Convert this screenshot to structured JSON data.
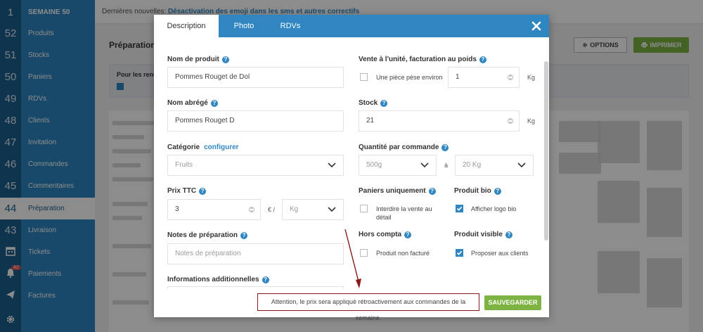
{
  "sidebar": {
    "week": {
      "num": "1",
      "label": "SEMAINE 50"
    },
    "items": [
      {
        "num": "52",
        "label": "Produits"
      },
      {
        "num": "51",
        "label": "Stocks"
      },
      {
        "num": "50",
        "label": "Paniers"
      },
      {
        "num": "49",
        "label": "RDVs"
      },
      {
        "num": "48",
        "label": "Clients"
      },
      {
        "num": "47",
        "label": "Invitation"
      },
      {
        "num": "46",
        "label": "Commandes"
      },
      {
        "num": "45",
        "label": "Commentaires"
      },
      {
        "num": "44",
        "label": "Préparation"
      },
      {
        "num": "43",
        "label": "Livraison"
      },
      {
        "icon": "calendar-icon",
        "label": "Tickets"
      },
      {
        "icon": "bell-icon",
        "label": "Paiements",
        "badge": "42"
      },
      {
        "icon": "paper-plane-icon",
        "label": "Factures"
      },
      {
        "icon": "gear-icon",
        "label": ""
      }
    ]
  },
  "topbar": {
    "news_prefix": "Dernières nouvelles:",
    "news_title": "Désactivation des emoji dans les sms et autres correctifs"
  },
  "page": {
    "title": "Préparation",
    "options_label": "OPTIONS",
    "print_label": "IMPRIMER",
    "filter_label": "Pour les rend"
  },
  "modal": {
    "tabs": [
      "Description",
      "Photo",
      "RDVs"
    ],
    "product_name": {
      "label": "Nom de produit",
      "value": "Pommes Rouget de Dol"
    },
    "short_name": {
      "label": "Nom abrégé",
      "value": "Pommes Rouget D"
    },
    "category": {
      "label": "Catégorie",
      "link": "configurer",
      "value": "Fruits"
    },
    "price": {
      "label": "Prix TTC",
      "value": "3",
      "currency": "€ /",
      "unit": "Kg"
    },
    "prep_notes": {
      "label": "Notes de préparation",
      "placeholder": "Notes de préparation"
    },
    "extra_info": {
      "label": "Informations additionnelles"
    },
    "unit_sale": {
      "label": "Vente à l'unité, facturation au poids",
      "checkbox_label": "Une pièce pèse environ",
      "checked": false,
      "value": "1",
      "unit": "Kg"
    },
    "stock": {
      "label": "Stock",
      "value": "21",
      "unit": "Kg"
    },
    "qty_per_order": {
      "label": "Quantité par commande",
      "min": "500g",
      "sep": "à",
      "max": "20 Kg"
    },
    "baskets_only": {
      "label": "Paniers uniquement",
      "checkbox_label": "Interdire la vente au détail",
      "checked": false
    },
    "organic": {
      "label": "Produit bio",
      "checkbox_label": "Afficher logo bio",
      "checked": true
    },
    "off_books": {
      "label": "Hors compta",
      "checkbox_label": "Produit non facturé",
      "checked": false
    },
    "visible": {
      "label": "Produit visible",
      "checkbox_label": "Proposer aux clients",
      "checked": true
    },
    "warning": "Attention, le prix sera appliqué rétroactivement aux commandes de la semaine.",
    "save_label": "SAUVEGARDER"
  },
  "colors": {
    "primary": "#2f86c1",
    "sidebar_dark": "#1d5f8c",
    "success": "#7cb342",
    "annotation": "#8b1a1a"
  }
}
